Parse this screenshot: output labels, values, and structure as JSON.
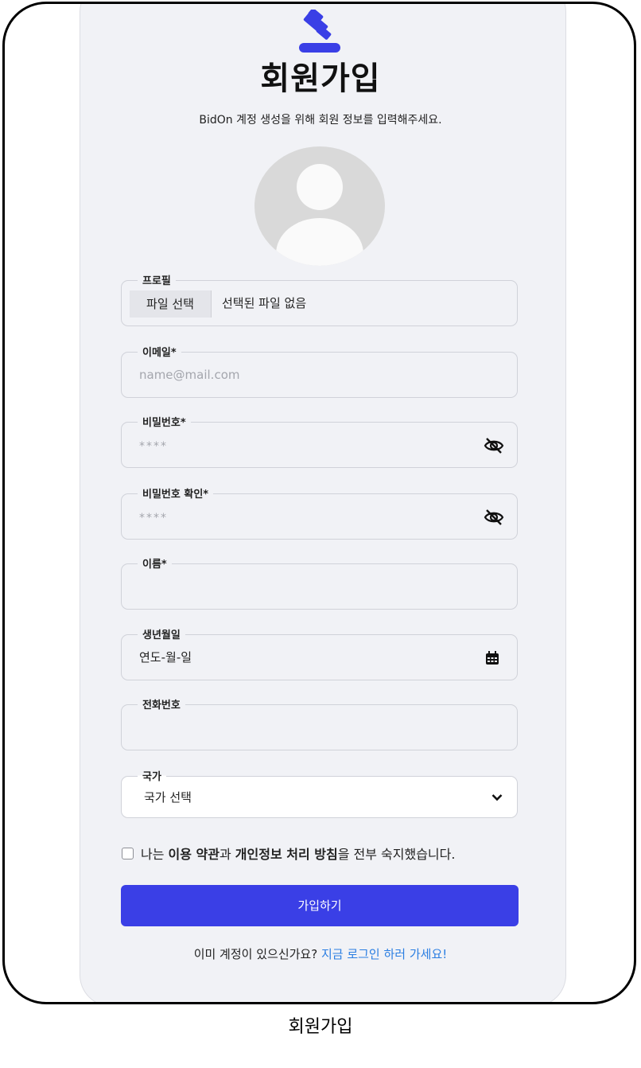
{
  "header": {
    "title": "회원가입",
    "subtitle": "BidOn 계정 생성을 위해 회원 정보를 입력해주세요.",
    "logo_icon": "gavel-icon",
    "accent_color": "#3a3fe6"
  },
  "form": {
    "profile": {
      "label": "프로필",
      "button": "파일 선택",
      "status": "선택된 파일 없음"
    },
    "email": {
      "label": "이메일*",
      "placeholder": "name@mail.com"
    },
    "password": {
      "label": "비밀번호*",
      "placeholder": "****",
      "icon": "eye-off-icon"
    },
    "password_confirm": {
      "label": "비밀번호 확인*",
      "placeholder": "****",
      "icon": "eye-off-icon"
    },
    "name": {
      "label": "이름*",
      "value": ""
    },
    "birthdate": {
      "label": "생년월일",
      "value": "연도-월-일",
      "icon": "calendar-icon"
    },
    "phone": {
      "label": "전화번호",
      "value": ""
    },
    "country": {
      "label": "국가",
      "selected": "국가 선택",
      "icon": "chevron-down-icon"
    },
    "agreement": {
      "prefix": "나는 ",
      "terms": "이용 약관",
      "mid": "과 ",
      "privacy": "개인정보 처리 방침",
      "suffix": "을 전부 숙지했습니다."
    },
    "submit_label": "가입하기"
  },
  "footer": {
    "prompt": "이미 계정이 있으신가요? ",
    "login_link": "지금 로그인 하러 가세요!",
    "link_color": "#2a7ee2"
  },
  "caption": "회원가입"
}
